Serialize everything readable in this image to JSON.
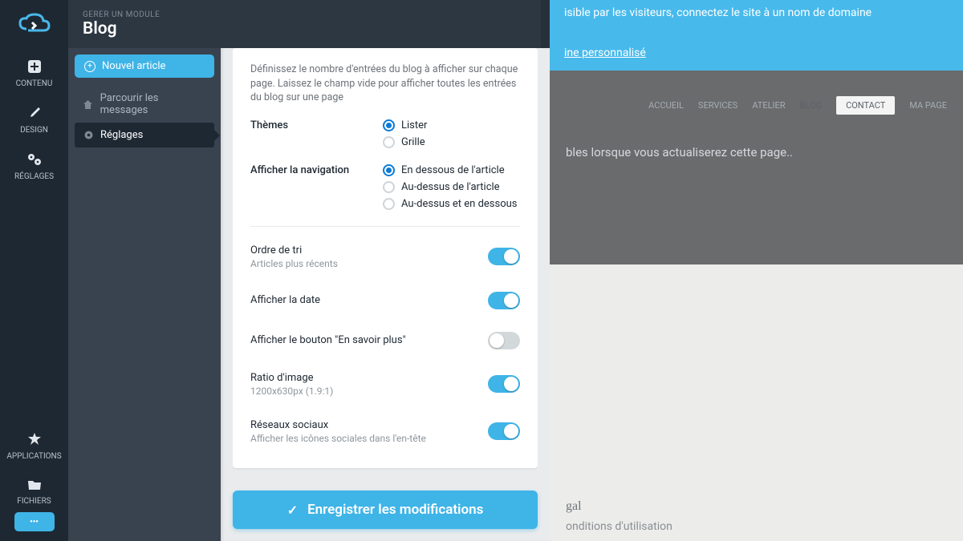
{
  "rail": {
    "contenu": "CONTENU",
    "design": "DESIGN",
    "reglages": "RÉGLAGES",
    "applications": "APPLICATIONS",
    "fichiers": "FICHIERS",
    "more": "•••"
  },
  "header": {
    "pretitle": "GERER UN MODULE",
    "title": "Blog"
  },
  "sidebar": {
    "new_article": "Nouvel article",
    "browse": "Parcourir les messages",
    "settings": "Réglages"
  },
  "settings": {
    "entries_desc": "Définissez le nombre d'entrées du blog à afficher sur chaque page. Laissez le champ vide pour afficher toutes les entrées du blog sur une page",
    "themes": {
      "label": "Thèmes",
      "options": {
        "lister": "Lister",
        "grille": "Grille"
      },
      "selected": "lister"
    },
    "navigation": {
      "label": "Afficher la navigation",
      "options": {
        "below": "En dessous de l'article",
        "above": "Au-dessus de l'article",
        "both": "Au-dessus et en dessous"
      },
      "selected": "below"
    },
    "sort": {
      "label": "Ordre de tri",
      "desc": "Articles plus récents",
      "on": true
    },
    "date": {
      "label": "Afficher la date",
      "on": true
    },
    "readmore": {
      "label": "Afficher le bouton \"En savoir plus\"",
      "on": false
    },
    "ratio": {
      "label": "Ratio d'image",
      "desc": "1200x630px (1.9:1)",
      "on": true
    },
    "social": {
      "label": "Réseaux sociaux",
      "desc": "Afficher les icônes sociales dans l'en-tête",
      "on": true
    },
    "save_label": "Enregistrer les modifications"
  },
  "backdrop": {
    "banner_text": "isible par les visiteurs, connectez le site à un nom de domaine",
    "banner_link": "ine personnalisé",
    "nav": {
      "accueil": "ACCUEIL",
      "services": "SERVICES",
      "atelier": "ATELIER",
      "blog": "BLOG",
      "contact": "CONTACT",
      "mapage": "MA PAGE"
    },
    "refresh": "bles lorsque vous actualiserez cette page..",
    "footer_title": "gal",
    "footer_terms": "onditions d'utilisation"
  }
}
